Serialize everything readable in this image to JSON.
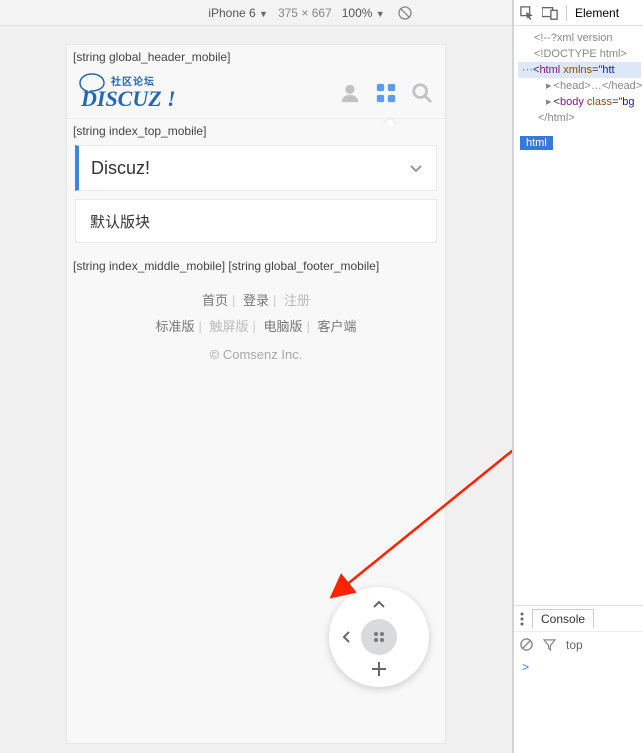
{
  "dev_toolbar": {
    "device": "iPhone 6",
    "width": "375",
    "x": "×",
    "height": "667",
    "zoom": "100%"
  },
  "preview": {
    "hook_header": "[string global_header_mobile]",
    "hook_index_top": "[string index_top_mobile]",
    "hook_middle_footer": "[string index_middle_mobile] [string global_footer_mobile]",
    "logo_tag": "社区论坛",
    "logo_text": "DISCUZ !",
    "forum_title": "Discuz!",
    "default_section": "默认版块",
    "footer": {
      "home": "首页",
      "login": "登录",
      "register": "注册",
      "standard": "标准版",
      "touch": "触屏版",
      "pc": "电脑版",
      "client": "客户端",
      "copyright": "© Comsenz Inc."
    }
  },
  "devtools": {
    "tab_elements": "Element",
    "code_xml": "<!--?xml version",
    "code_doctype": "<!DOCTYPE html>",
    "code_html_open": "html",
    "code_xmlns_attr": "xmlns",
    "code_xmlns_val": "\"htt",
    "code_head": "<head>…</head>",
    "code_body": "body",
    "code_class_attr": "class",
    "code_class_val": "\"bg",
    "code_html_close": "</html>",
    "breadcrumb": "html",
    "console_tab": "Console",
    "filter_top": "top",
    "prompt": ">"
  }
}
